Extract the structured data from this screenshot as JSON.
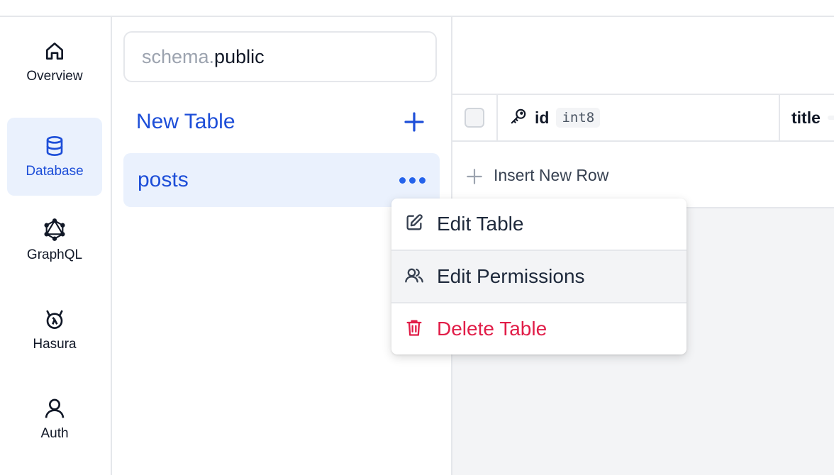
{
  "nav": {
    "items": [
      {
        "label": "Overview",
        "icon": "home-icon"
      },
      {
        "label": "Database",
        "icon": "database-icon",
        "active": true
      },
      {
        "label": "GraphQL",
        "icon": "graphql-icon"
      },
      {
        "label": "Hasura",
        "icon": "hasura-icon"
      },
      {
        "label": "Auth",
        "icon": "user-icon"
      }
    ]
  },
  "tables": {
    "schema_prefix": "schema.",
    "schema_name": "public",
    "new_table_label": "New Table",
    "items": [
      {
        "label": "posts"
      }
    ]
  },
  "grid": {
    "columns": [
      {
        "name": "id",
        "type": "int8",
        "icon": "key-icon"
      },
      {
        "name": "title",
        "type": ""
      }
    ],
    "insert_label": "Insert New Row"
  },
  "menu": {
    "items": [
      {
        "label": "Edit Table",
        "icon": "edit-icon"
      },
      {
        "label": "Edit Permissions",
        "icon": "users-icon"
      },
      {
        "label": "Delete Table",
        "icon": "trash-icon"
      }
    ]
  },
  "colors": {
    "accent": "#1d4ed8",
    "active_bg": "#eaf1fd",
    "danger": "#e11d48"
  }
}
